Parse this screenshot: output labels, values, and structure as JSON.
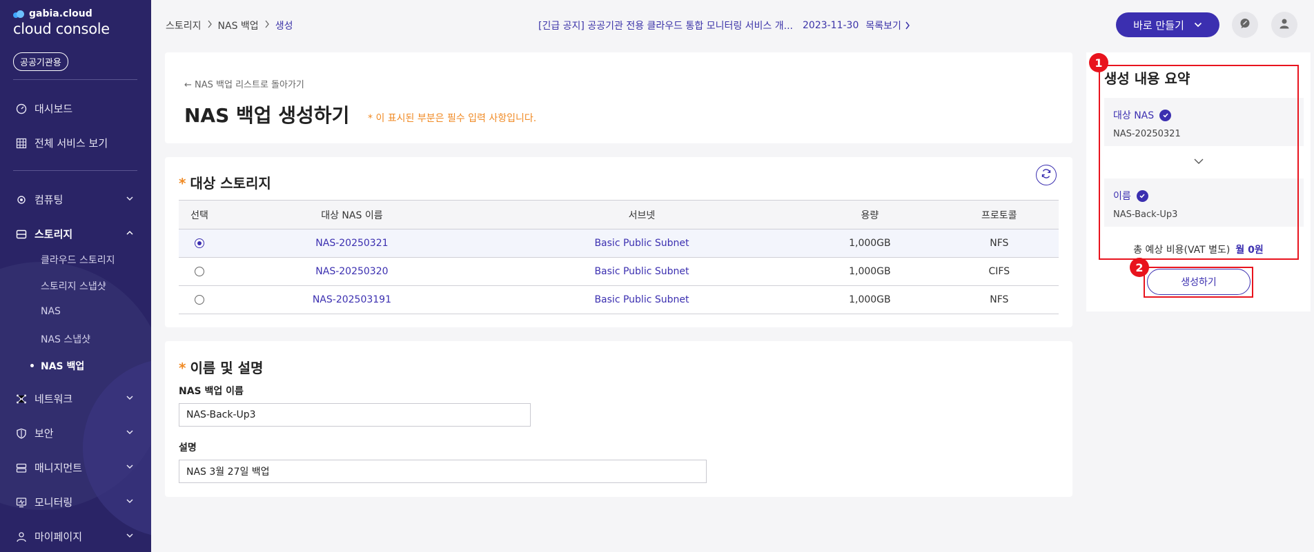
{
  "sidebar": {
    "brand_small": "gabia.cloud",
    "brand_large": "cloud console",
    "badge": "공공기관용",
    "items": [
      {
        "label": "대시보드",
        "icon": "gauge-icon"
      },
      {
        "label": "전체 서비스 보기",
        "icon": "grid-icon"
      },
      {
        "label": "컴퓨팅",
        "icon": "chip-icon"
      },
      {
        "label": "스토리지",
        "icon": "storage-icon"
      },
      {
        "label": "네트워크",
        "icon": "network-icon"
      },
      {
        "label": "보안",
        "icon": "shield-icon"
      },
      {
        "label": "매니지먼트",
        "icon": "server-icon"
      },
      {
        "label": "모니터링",
        "icon": "monitor-icon"
      },
      {
        "label": "마이페이지",
        "icon": "user-icon"
      }
    ],
    "storage_sub": [
      "클라우드 스토리지",
      "스토리지 스냅샷",
      "NAS",
      "NAS 스냅샷",
      "NAS 백업"
    ]
  },
  "header": {
    "breadcrumb": [
      "스토리지",
      "NAS 백업",
      "생성"
    ],
    "notice_text": "[긴급 공지] 공공기관 전용 클라우드 통합 모니터링 서비스 개...",
    "notice_date": "2023-11-30",
    "notice_more": "목록보기",
    "quick_create": "바로 만들기"
  },
  "page": {
    "back_link": "← NAS 백업 리스트로 돌아가기",
    "title": "NAS 백업 생성하기",
    "required_note": "* 이 표시된 부분은 필수 입력 사항입니다."
  },
  "storage_section": {
    "star": "*",
    "title": "대상 스토리지",
    "columns": [
      "선택",
      "대상 NAS 이름",
      "서브넷",
      "용량",
      "프로토콜"
    ],
    "rows": [
      {
        "name": "NAS-20250321",
        "subnet": "Basic Public Subnet",
        "capacity": "1,000GB",
        "protocol": "NFS",
        "selected": true
      },
      {
        "name": "NAS-20250320",
        "subnet": "Basic Public Subnet",
        "capacity": "1,000GB",
        "protocol": "CIFS",
        "selected": false
      },
      {
        "name": "NAS-202503191",
        "subnet": "Basic Public Subnet",
        "capacity": "1,000GB",
        "protocol": "NFS",
        "selected": false
      }
    ]
  },
  "name_section": {
    "star": "*",
    "title": "이름 및 설명",
    "name_label": "NAS 백업 이름",
    "name_value": "NAS-Back-Up3",
    "desc_label": "설명",
    "desc_value": "NAS 3월 27일 백업"
  },
  "summary": {
    "title": "생성 내용 요약",
    "target_label": "대상 NAS",
    "target_value": "NAS-20250321",
    "name_label": "이름",
    "name_value": "NAS-Back-Up3",
    "cost_label": "총 예상 비용(VAT 별도)",
    "cost_value": "월 0원",
    "create_button": "생성하기",
    "marker_1": "1",
    "marker_2": "2"
  },
  "colors": {
    "sidebar_bg": "#2a2466",
    "accent": "#3b2fb0",
    "required": "#f08a24",
    "highlight": "#e8131d"
  }
}
